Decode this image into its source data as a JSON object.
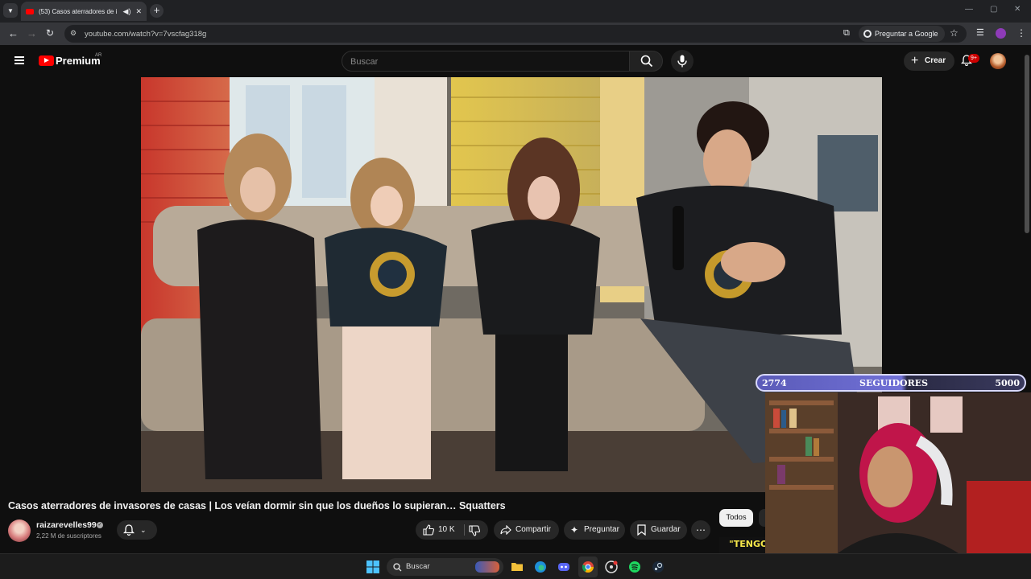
{
  "browser": {
    "tab_title": "(53) Casos aterradores de i",
    "url": "youtube.com/watch?v=7vscfag318g",
    "ask_google": "Preguntar a Google"
  },
  "youtube": {
    "logo_text": "Premium",
    "country_code": "AR",
    "search_placeholder": "Buscar",
    "create_label": "Crear",
    "notifications_badge": "9+"
  },
  "overlay": {
    "followers_current": "2774",
    "followers_label": "SEGUIDORES",
    "followers_goal": "5000",
    "followers_progress": 0.555
  },
  "video": {
    "title": "Casos aterradores de invasores de casas | Los veían dormir sin que los dueños lo supieran… Squatters",
    "channel_name": "raizarevelles99",
    "subscribers": "2,22 M de suscriptores",
    "likes": "10 K",
    "share_label": "Compartir",
    "ask_label": "Preguntar",
    "save_label": "Guardar"
  },
  "chips": {
    "all": "Todos",
    "partial_thumb_text": "\"TENGO"
  },
  "taskbar": {
    "search_label": "Buscar"
  },
  "icons": [
    "chevron-down-icon",
    "speaker-icon",
    "close-icon",
    "plus-icon",
    "back-icon",
    "forward-icon",
    "reload-icon",
    "site-info-icon",
    "install-icon",
    "google-lens-icon",
    "star-icon",
    "reading-list-icon",
    "profile-icon",
    "kebab-icon",
    "hamburger-icon",
    "youtube-logo-icon",
    "search-icon",
    "mic-icon",
    "bell-icon",
    "thumbs-up-icon",
    "thumbs-down-icon",
    "share-icon",
    "sparkle-icon",
    "bookmark-icon",
    "more-icon",
    "windows-icon",
    "folder-icon",
    "edge-icon",
    "discord-icon",
    "chrome-icon",
    "steam-icon",
    "spotify-icon"
  ]
}
